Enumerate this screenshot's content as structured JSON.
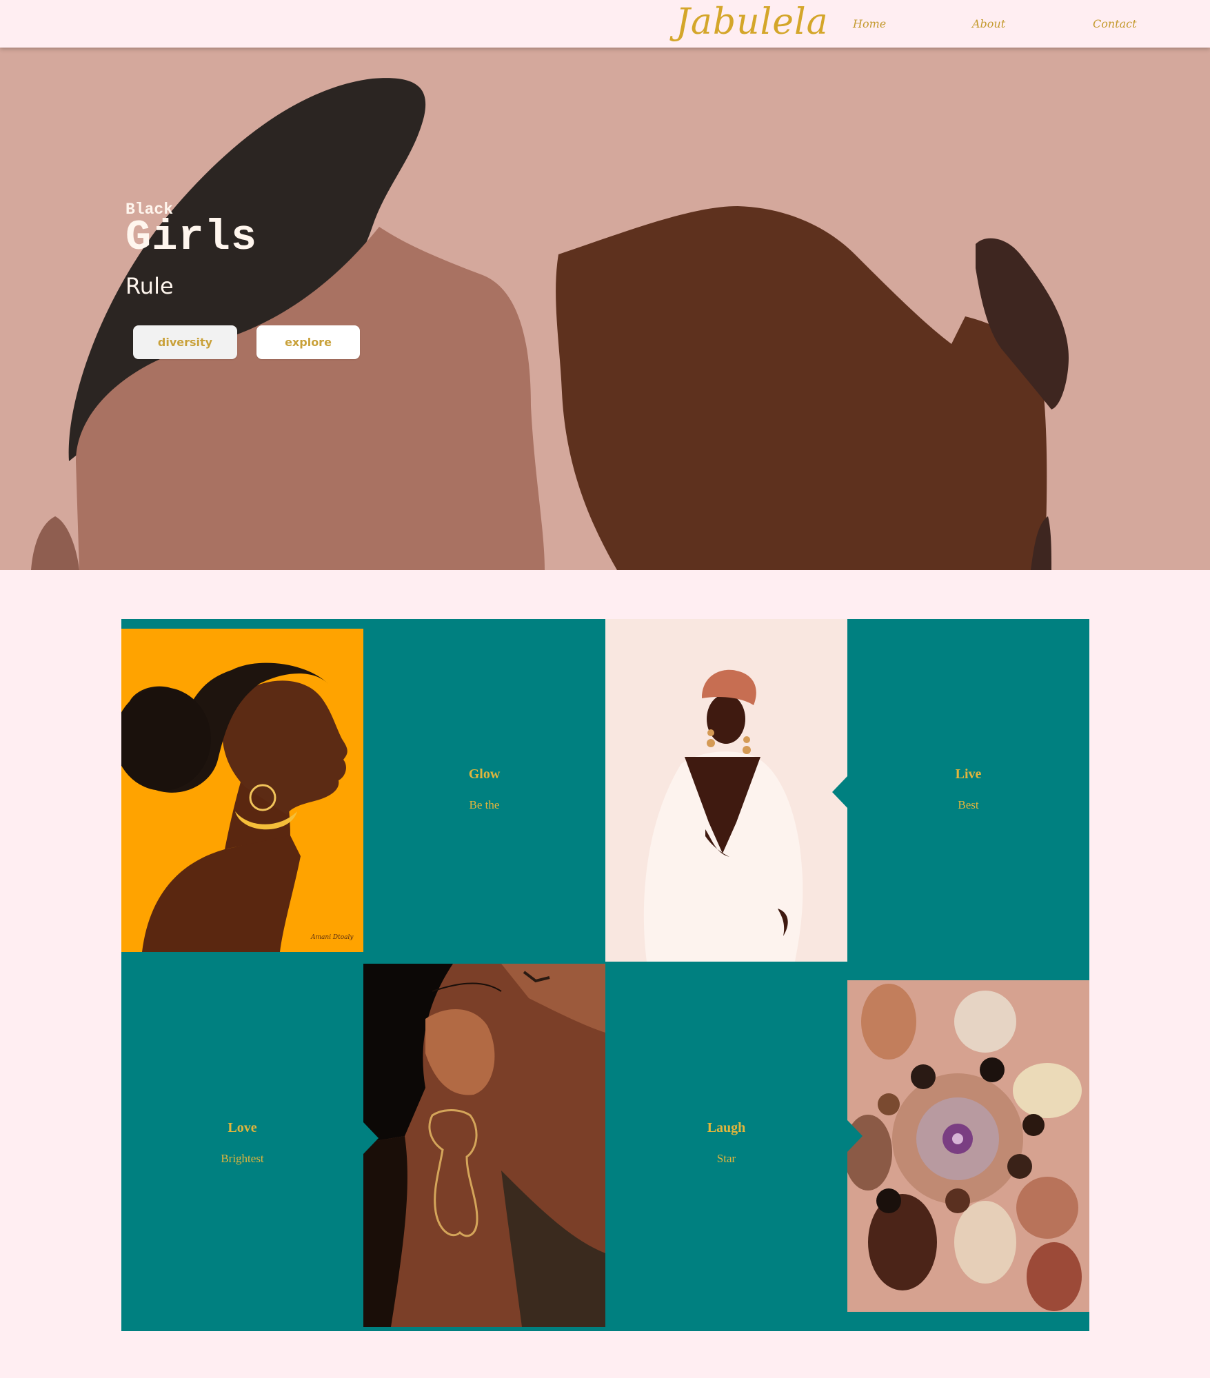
{
  "header": {
    "logo": "Jabulela",
    "nav": [
      "Home",
      "About",
      "Contact"
    ]
  },
  "hero": {
    "line1": "Black",
    "line2": "Girls",
    "line3": "Rule",
    "buttons": [
      "diversity",
      "explore"
    ]
  },
  "cards": [
    {
      "title": "Glow",
      "subtitle": "Be the"
    },
    {
      "title": "Live",
      "subtitle": "Best"
    },
    {
      "title": "Love",
      "subtitle": "Brightest"
    },
    {
      "title": "Laugh",
      "subtitle": "Star"
    }
  ],
  "colors": {
    "background": "#FFEEF2",
    "accent_gold": "#D4A62A",
    "teal": "#008080",
    "hero_bg": "#D4A79B"
  }
}
